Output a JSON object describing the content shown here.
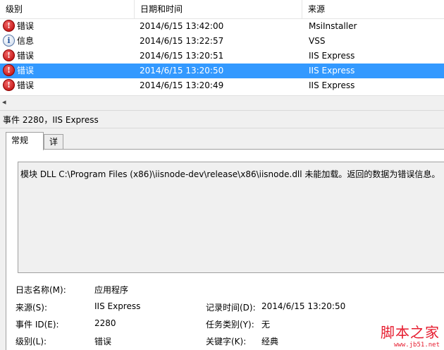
{
  "list": {
    "columns": [
      "级别",
      "日期和时间",
      "来源"
    ],
    "rows": [
      {
        "level_icon": "error-icon",
        "level": "错误",
        "datetime": "2014/6/15 13:42:00",
        "source": "MsiInstaller"
      },
      {
        "level_icon": "info-icon",
        "level": "信息",
        "datetime": "2014/6/15 13:22:57",
        "source": "VSS"
      },
      {
        "level_icon": "error-icon",
        "level": "错误",
        "datetime": "2014/6/15 13:20:51",
        "source": "IIS Express"
      },
      {
        "level_icon": "error-icon",
        "level": "错误",
        "datetime": "2014/6/15 13:20:50",
        "source": "IIS Express",
        "selected": true
      },
      {
        "level_icon": "error-icon",
        "level": "错误",
        "datetime": "2014/6/15 13:20:49",
        "source": "IIS Express"
      }
    ],
    "scroll_left": "◂"
  },
  "detail": {
    "title": "事件 2280，IIS Express",
    "tabs": [
      "常规",
      "详细信息"
    ],
    "message": "模块 DLL C:\\Program Files (x86)\\iisnode-dev\\release\\x86\\iisnode.dll 未能加载。返回的数据为错误信息。",
    "fields": {
      "log_name_label": "日志名称(M):",
      "log_name": "应用程序",
      "source_label": "来源(S):",
      "source": "IIS Express",
      "logged_label": "记录时间(D):",
      "logged": "2014/6/15 13:20:50",
      "event_id_label": "事件 ID(E):",
      "event_id": "2280",
      "task_label": "任务类别(Y):",
      "task": "无",
      "level_label": "级别(L):",
      "level": "错误",
      "keywords_label": "关键字(K):",
      "keywords": "经典"
    }
  },
  "watermark": {
    "main": "脚本之家",
    "sub": "www.jb51.net"
  },
  "colors": {
    "selection": "#3399ff",
    "error": "#c00000",
    "watermark": "#e61b2e"
  }
}
